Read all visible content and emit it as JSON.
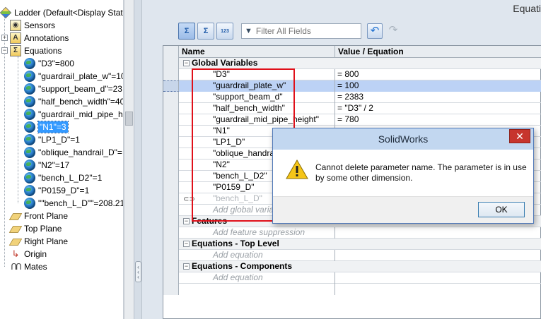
{
  "feature_tree": {
    "root_label": "Ladder  (Default<Display State",
    "items": [
      {
        "label": "Sensors",
        "icon": "sensor-icon"
      },
      {
        "label": "Annotations",
        "icon": "annotations-icon"
      },
      {
        "label": "Equations",
        "icon": "equations-icon"
      },
      {
        "label": "\"D3\"=800",
        "icon": "global-variable-icon"
      },
      {
        "label": "\"guardrail_plate_w\"=10",
        "icon": "global-variable-icon"
      },
      {
        "label": "\"support_beam_d\"=23",
        "icon": "global-variable-icon"
      },
      {
        "label": "\"half_bench_width\"=40",
        "icon": "global-variable-icon"
      },
      {
        "label": "\"guardrail_mid_pipe_h",
        "icon": "global-variable-icon"
      },
      {
        "label": "\"N1\"=3",
        "icon": "global-variable-icon",
        "selected": true
      },
      {
        "label": "\"LP1_D\"=1",
        "icon": "global-variable-icon"
      },
      {
        "label": "\"oblique_handrail_D\"=",
        "icon": "global-variable-icon"
      },
      {
        "label": "\"N2\"=17",
        "icon": "global-variable-icon"
      },
      {
        "label": "\"bench_L_D2\"=1",
        "icon": "global-variable-icon"
      },
      {
        "label": "\"P0159_D\"=1",
        "icon": "global-variable-icon"
      },
      {
        "label": "\"\"bench_L_D\"\"=208.21",
        "icon": "global-variable-icon"
      },
      {
        "label": "Front Plane",
        "icon": "plane-icon"
      },
      {
        "label": "Top Plane",
        "icon": "plane-icon"
      },
      {
        "label": "Right Plane",
        "icon": "plane-icon"
      },
      {
        "label": "Origin",
        "icon": "origin-icon"
      },
      {
        "label": "Mates",
        "icon": "mates-icon"
      }
    ]
  },
  "equations": {
    "window_title": "Equati",
    "toolbar": {
      "filter_placeholder": "Filter All Fields",
      "tb1": "Σ",
      "tb2": "Σ",
      "tb3_sub": "123"
    },
    "columns": {
      "name": "Name",
      "value": "Value / Equation"
    },
    "sections": {
      "global": "Global Variables",
      "features": "Features",
      "top_level": "Equations - Top Level",
      "components": "Equations - Components"
    },
    "global_rows": [
      {
        "name": "\"D3\"",
        "value": "= 800"
      },
      {
        "name": "\"guardrail_plate_w\"",
        "value": "= 100",
        "selected": true
      },
      {
        "name": "\"support_beam_d\"",
        "value": "= 2383"
      },
      {
        "name": "\"half_bench_width\"",
        "value": "= \"D3\" / 2"
      },
      {
        "name": "\"guardrail_mid_pipe_height\"",
        "value": "= 780"
      },
      {
        "name": "\"N1\"",
        "value": ""
      },
      {
        "name": "\"LP1_D\"",
        "value": ""
      },
      {
        "name": "\"oblique_handrail_D\"",
        "value": ""
      },
      {
        "name": "\"N2\"",
        "value": ""
      },
      {
        "name": "\"bench_L_D2\"",
        "value": ""
      },
      {
        "name": "\"P0159_D\"",
        "value": ""
      },
      {
        "name": "\"bench_L_D\"",
        "value": "",
        "disabled": true
      }
    ],
    "add_global": "Add global variable",
    "add_feature": "Add feature suppression",
    "add_equation_top": "Add equation",
    "add_equation_comp": "Add equation"
  },
  "dialog": {
    "title": "SolidWorks",
    "close": "✕",
    "message": "Cannot delete parameter name. The parameter is in use by some other dimension.",
    "ok_label": "OK",
    "icon": "warning-icon"
  },
  "colors": {
    "highlight_box": "#e0101a",
    "selection": "#3399ff",
    "close_button": "#c7352d"
  }
}
